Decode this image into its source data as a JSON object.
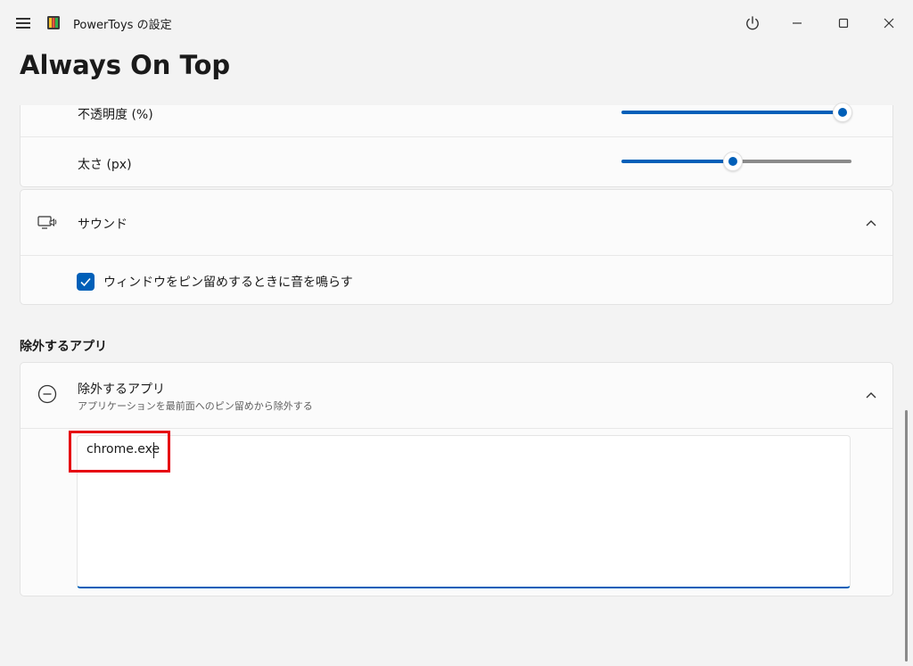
{
  "app": {
    "title": "PowerToys の設定",
    "page_title": "Always On Top"
  },
  "appearance": {
    "opacity_label": "不透明度 (%)",
    "opacity_value_percent": 100,
    "thickness_label": "太さ (px)",
    "thickness_value_fraction": 0.49
  },
  "sound": {
    "title": "サウンド",
    "checkbox_label": "ウィンドウをピン留めするときに音を鳴らす",
    "checkbox_checked": true
  },
  "excluded": {
    "section_header": "除外するアプリ",
    "card_title": "除外するアプリ",
    "card_description": "アプリケーションを最前面へのピン留めから除外する",
    "textarea_value": "chrome.exe"
  },
  "icons": {
    "menu": "hamburger-icon",
    "logo": "powertoys-logo",
    "power": "power-icon",
    "minimize": "minimize-icon",
    "maximize": "maximize-icon",
    "close": "close-icon",
    "sound": "monitor-speaker-icon",
    "exclude": "minus-circle-icon",
    "chevron": "chevron-up-icon",
    "check": "checkmark-icon"
  },
  "colors": {
    "accent": "#005fb8",
    "highlight": "#e60012",
    "background": "#f3f3f3"
  }
}
